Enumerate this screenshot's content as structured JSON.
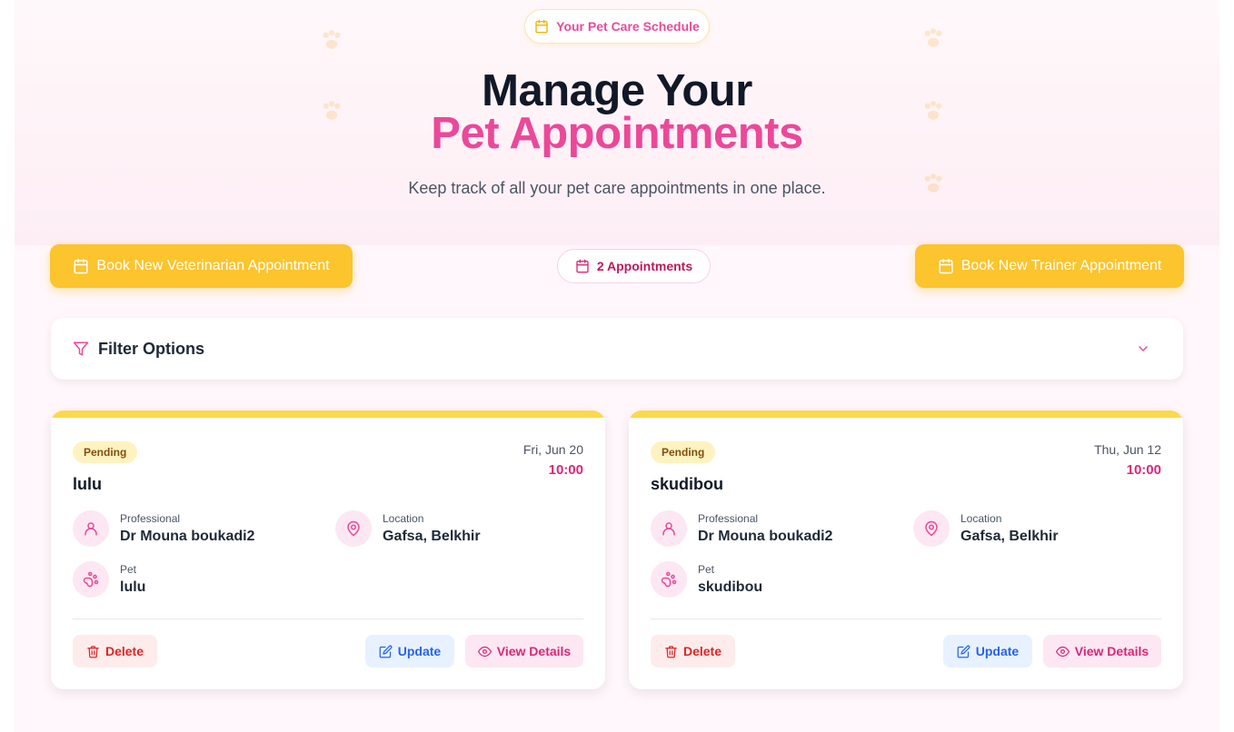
{
  "header": {
    "schedule_pill": "Your Pet Care Schedule",
    "title_line1": "Manage Your",
    "title_line2": "Pet Appointments",
    "subtitle": "Keep track of all your pet care appointments in one place."
  },
  "actions": {
    "book_vet_label": "Book New Veterinarian Appointment",
    "appointments_count": "2 Appointments",
    "book_trainer_label": "Book New Trainer Appointment"
  },
  "filter": {
    "label": "Filter Options"
  },
  "labels": {
    "professional": "Professional",
    "location": "Location",
    "pet": "Pet"
  },
  "buttons": {
    "delete": "Delete",
    "update": "Update",
    "view_details": "View Details"
  },
  "appointments": [
    {
      "status": "Pending",
      "title": "lulu",
      "date": "Fri, Jun 20",
      "time": "10:00",
      "professional": "Dr Mouna boukadi2",
      "location": "Gafsa, Belkhir",
      "pet": "lulu"
    },
    {
      "status": "Pending",
      "title": "skudibou",
      "date": "Thu, Jun 12",
      "time": "10:00",
      "professional": "Dr Mouna boukadi2",
      "location": "Gafsa, Belkhir",
      "pet": "skudibou"
    }
  ],
  "colors": {
    "accent_pink": "#ec4899",
    "accent_yellow": "#fcc42d",
    "status_pending_bg": "#fef3c0",
    "delete": "#dc2626",
    "update": "#2563eb"
  },
  "icons": {
    "calendar": "calendar-icon",
    "filter": "filter-icon",
    "chevron": "chevron-down-icon",
    "user": "user-icon",
    "location": "map-pin-icon",
    "pet": "paw-icon",
    "delete": "trash-icon",
    "update": "edit-icon",
    "view": "eye-icon"
  }
}
